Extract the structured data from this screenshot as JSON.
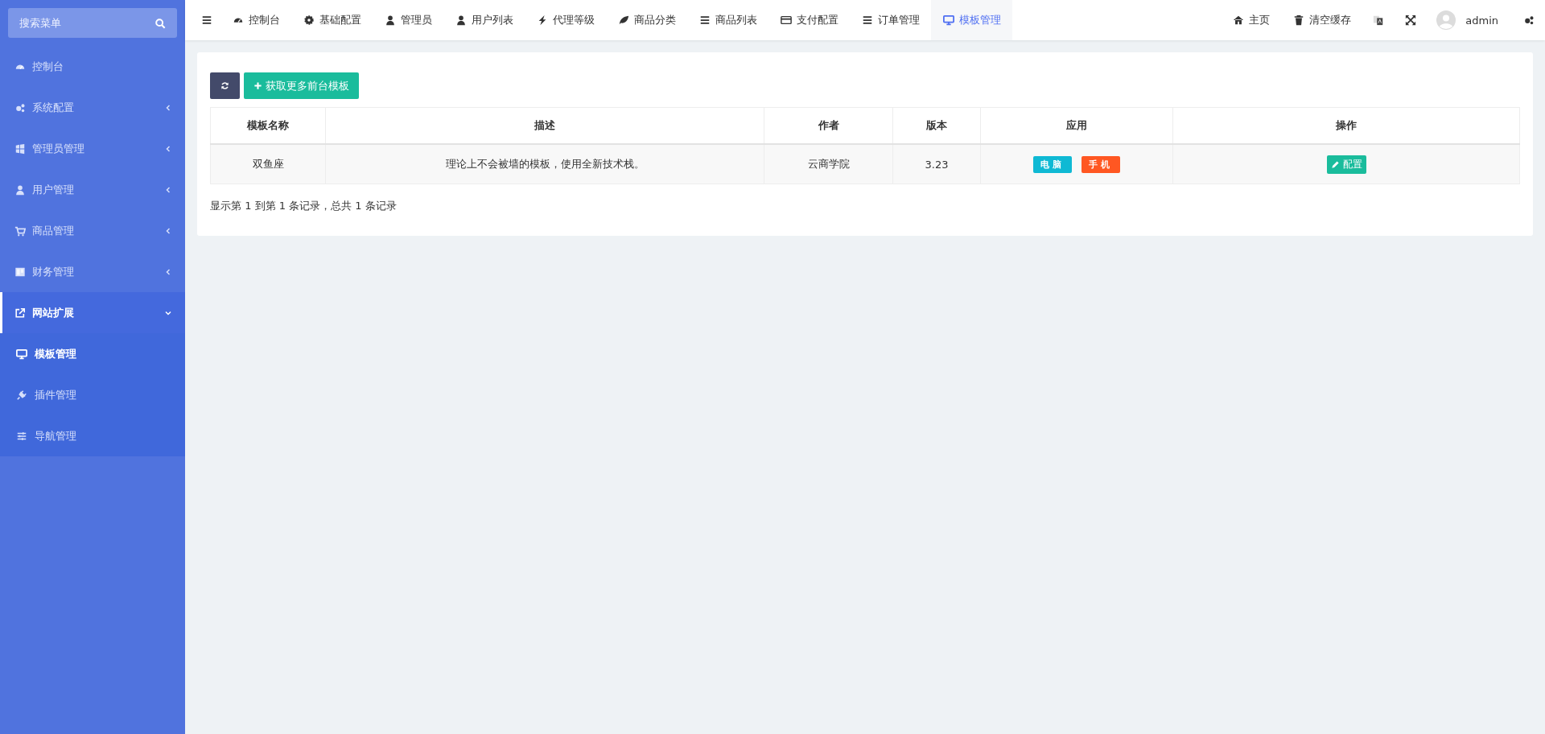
{
  "sidebar": {
    "search": {
      "placeholder": "搜索菜单"
    },
    "items": [
      {
        "label": "控制台",
        "kind": "link"
      },
      {
        "label": "系统配置",
        "kind": "group",
        "expanded": false
      },
      {
        "label": "管理员管理",
        "kind": "group",
        "expanded": false
      },
      {
        "label": "用户管理",
        "kind": "group",
        "expanded": false
      },
      {
        "label": "商品管理",
        "kind": "group",
        "expanded": false
      },
      {
        "label": "财务管理",
        "kind": "group",
        "expanded": false
      },
      {
        "label": "网站扩展",
        "kind": "group",
        "expanded": true,
        "children": [
          {
            "label": "模板管理",
            "selected": true
          },
          {
            "label": "插件管理",
            "selected": false
          },
          {
            "label": "导航管理",
            "selected": false
          }
        ]
      }
    ]
  },
  "topbar": {
    "tabs": [
      {
        "label": "控制台",
        "selected": false
      },
      {
        "label": "基础配置",
        "selected": false
      },
      {
        "label": "管理员",
        "selected": false
      },
      {
        "label": "用户列表",
        "selected": false
      },
      {
        "label": "代理等级",
        "selected": false
      },
      {
        "label": "商品分类",
        "selected": false
      },
      {
        "label": "商品列表",
        "selected": false
      },
      {
        "label": "支付配置",
        "selected": false
      },
      {
        "label": "订单管理",
        "selected": false
      },
      {
        "label": "模板管理",
        "selected": true
      }
    ],
    "links": [
      "主页",
      "清空缓存"
    ],
    "user": "admin"
  },
  "toolbar": {
    "add_button": "获取更多前台模板"
  },
  "table": {
    "columns": [
      "模板名称",
      "描述",
      "作者",
      "版本",
      "应用",
      "操作"
    ],
    "rows": [
      {
        "name": "双鱼座",
        "description": "理论上不会被墙的模板，使用全新技术栈。",
        "author": "云商学院",
        "version": "3.23",
        "platforms": [
          {
            "label": "电脑",
            "color": "#0fb9d4"
          },
          {
            "label": "手机",
            "color": "#ff5722"
          }
        ],
        "action": "配置"
      }
    ]
  },
  "pagination": "显示第 1 到第 1 条记录，总共 1 条记录"
}
